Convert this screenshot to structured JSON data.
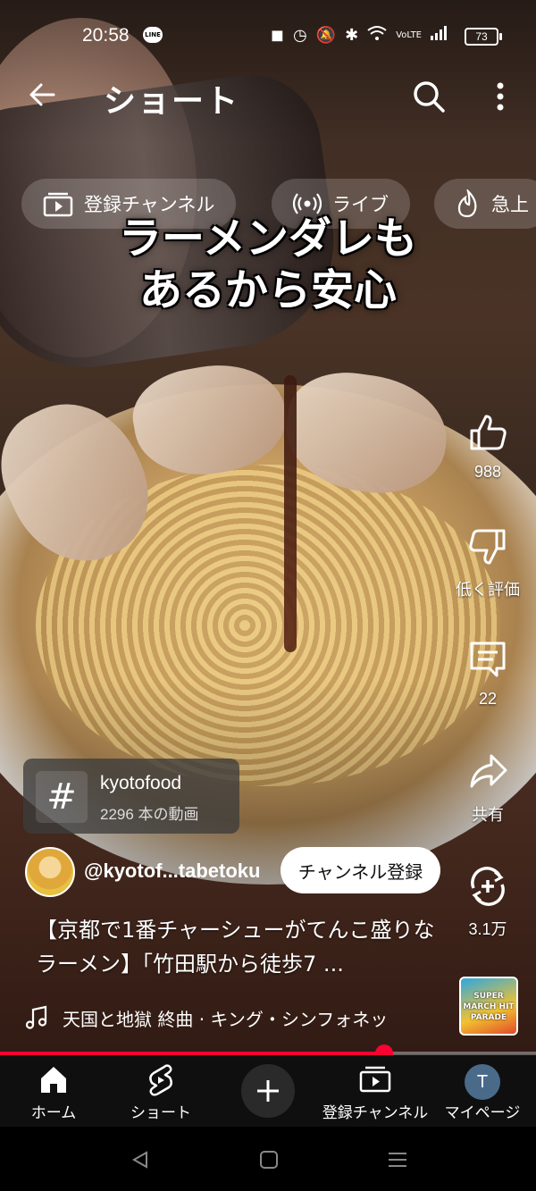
{
  "status_bar": {
    "time": "20:58",
    "line_badge": "LINE",
    "battery": "73"
  },
  "header": {
    "title": "ショート"
  },
  "chips": [
    {
      "label": "登録チャンネル",
      "icon": "subscriptions-icon"
    },
    {
      "label": "ライブ",
      "icon": "live-icon"
    },
    {
      "label": "急上",
      "icon": "trending-icon"
    }
  ],
  "caption": {
    "line1": "ラーメンダレも",
    "line2": "あるから安心"
  },
  "actions": {
    "like_count": "988",
    "dislike_label": "低く評価",
    "comments_count": "22",
    "share_label": "共有",
    "remix_count": "3.1万"
  },
  "hashtag": {
    "name": "kyotofood",
    "video_count": "2296 本の動画",
    "icon": "#"
  },
  "channel": {
    "handle": "@kyotof...tabetoku",
    "subscribe_label": "チャンネル登録"
  },
  "video_title": "【京都で1番チャーシューがてんこ盛りなラーメン】「竹田駅から徒歩7 ...",
  "music": {
    "track": "天国と地獄 終曲 · キング・シンフォネッ",
    "thumb_text": "SUPER MARCH HIT PARADE"
  },
  "progress": {
    "fraction": 0.717
  },
  "bottom_nav": {
    "home": "ホーム",
    "shorts": "ショート",
    "subscriptions": "登録チャンネル",
    "mypage": "マイページ",
    "mypage_initial": "T"
  },
  "colors": {
    "accent_red": "#ff0033",
    "nav_bg": "#0f0f0f"
  }
}
